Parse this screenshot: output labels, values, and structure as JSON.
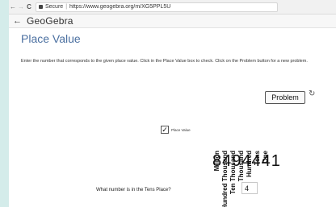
{
  "browser": {
    "back_glyph": "←",
    "forward_glyph": "→",
    "reload_glyph": "C",
    "secure_label": "Secure",
    "separator": "|",
    "url": "https://www.geogebra.org/m/XG5PPL5U"
  },
  "app": {
    "back_glyph": "←",
    "brand": "GeoGebra"
  },
  "page": {
    "title": "Place Value",
    "instructions": "Enter the number that corresponds to the given place value. Click in the Place Value box to check. Click on the Problem button for a new problem."
  },
  "controls": {
    "problem_label": "Problem",
    "refresh_glyph": "↻",
    "place_value_checkbox": {
      "checked": true,
      "check_glyph": "✓",
      "label": "Place Value"
    }
  },
  "place_labels": [
    "Million",
    "Hundred Thousand",
    "Ten Thousand",
    "Thousand",
    "Hundred",
    "Tens",
    "One"
  ],
  "number": "8494441",
  "question": {
    "text": "What number is in the Tens Place?",
    "answer": "4"
  }
}
